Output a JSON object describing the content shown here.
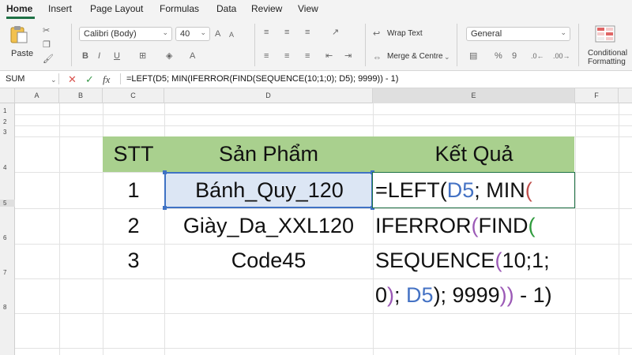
{
  "ribbon": {
    "tabs": [
      "Home",
      "Insert",
      "Page Layout",
      "Formulas",
      "Data",
      "Review",
      "View"
    ],
    "paste_label": "Paste",
    "font_name": "Calibri (Body)",
    "font_size": "40",
    "bold": "B",
    "italic": "I",
    "underline": "U",
    "wrap_text": "Wrap Text",
    "merge_center": "Merge & Centre",
    "number_format": "General",
    "conditional_formatting_line1": "Conditional",
    "conditional_formatting_line2": "Formatting"
  },
  "formula_bar": {
    "name_box": "SUM",
    "cancel_icon": "✕",
    "enter_icon": "✓",
    "fx_label": "fx",
    "formula": "=LEFT(D5; MIN(IFERROR(FIND(SEQUENCE(10;1;0); D5); 9999)) - 1)"
  },
  "columns": [
    "A",
    "B",
    "C",
    "D",
    "E",
    "F"
  ],
  "rows": [
    "1",
    "2",
    "3",
    "4",
    "5",
    "6",
    "7",
    "8"
  ],
  "table": {
    "headers": [
      "STT",
      "Sản Phẩm",
      "Kết Quả"
    ],
    "stt": [
      "1",
      "2",
      "3"
    ],
    "products": [
      "Bánh_Quy_120",
      "Giày_Da_XXL120",
      "Code45"
    ]
  },
  "edit_formula": {
    "line1": {
      "a": "=LEFT(",
      "b": "D5",
      "c": "; MIN",
      "d": "("
    },
    "line2": {
      "a": "IFERROR",
      "b": "(",
      "c": "FIND",
      "d": "("
    },
    "line3": {
      "a": "SEQUENCE",
      "b": "(",
      "c": "10;1;"
    },
    "line4": {
      "a": "0",
      "b": ")",
      "c": "; ",
      "d": "D5",
      "e": "); 9999",
      "f": "))",
      "g": " - 1)"
    }
  },
  "colors": {
    "accent": "#1e7145",
    "header_fill": "#a9d08e",
    "selection_fill": "#dce6f4",
    "selection_border": "#3f72c4",
    "ref_blue": "#4472c4",
    "paren_green": "#2e9a3c",
    "paren_purple": "#9b59b6",
    "paren_red": "#c0504d"
  }
}
